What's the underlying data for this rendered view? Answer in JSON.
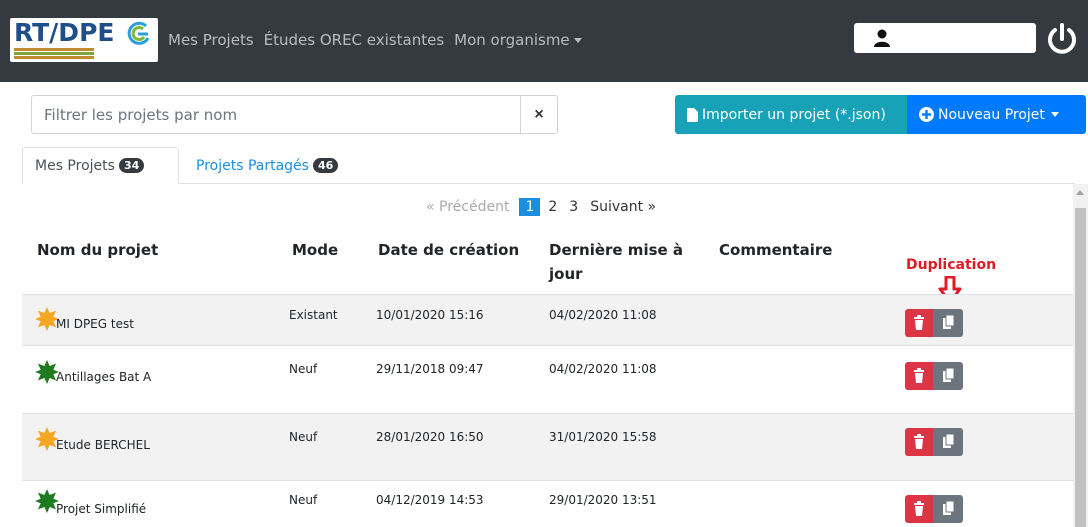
{
  "navbar": {
    "logo_text": "RT/DPE",
    "links": [
      "Mes Projets",
      "Études OREC existantes",
      "Mon organisme"
    ]
  },
  "toolbar": {
    "filter_placeholder": "Filtrer les projets par nom",
    "clear_label": "×",
    "import_label": "Importer un projet (*.json)",
    "new_label": "Nouveau Projet"
  },
  "tabs": [
    {
      "label": "Mes Projets",
      "count": "34"
    },
    {
      "label": "Projets Partagés",
      "count": "46"
    }
  ],
  "pagination": {
    "prev": "« Précédent",
    "pages": [
      "1",
      "2",
      "3"
    ],
    "next": "Suivant »"
  },
  "table": {
    "headers": {
      "name": "Nom du projet",
      "mode": "Mode",
      "created": "Date de création",
      "updated": "Dernière mise à jour",
      "comment": "Commentaire"
    },
    "rows": [
      {
        "name": "MI DPEG test",
        "mode": "Existant",
        "created": "10/01/2020 15:16",
        "updated": "04/02/2020 11:08",
        "icon": "orange-star-icon"
      },
      {
        "name": "Antillages Bat A",
        "mode": "Neuf",
        "created": "29/11/2018 09:47",
        "updated": "04/02/2020 11:08",
        "icon": "green-star-icon"
      },
      {
        "name": "Etude BERCHEL",
        "mode": "Neuf",
        "created": "28/01/2020 16:50",
        "updated": "31/01/2020 15:58",
        "icon": "orange-star-icon"
      },
      {
        "name": "Projet Simplifié",
        "mode": "Neuf",
        "created": "04/12/2019 14:53",
        "updated": "29/01/2020 13:51",
        "icon": "green-star-icon"
      }
    ]
  },
  "annotation": {
    "label": "Duplication"
  },
  "colors": {
    "navbar": "#343a40",
    "import": "#17a2b8",
    "new": "#007bff",
    "delete": "#dc3545",
    "duplicate": "#6c757d",
    "annotation": "#e01b24",
    "star_orange": "#f5a623",
    "star_green": "#1e7b1e"
  }
}
